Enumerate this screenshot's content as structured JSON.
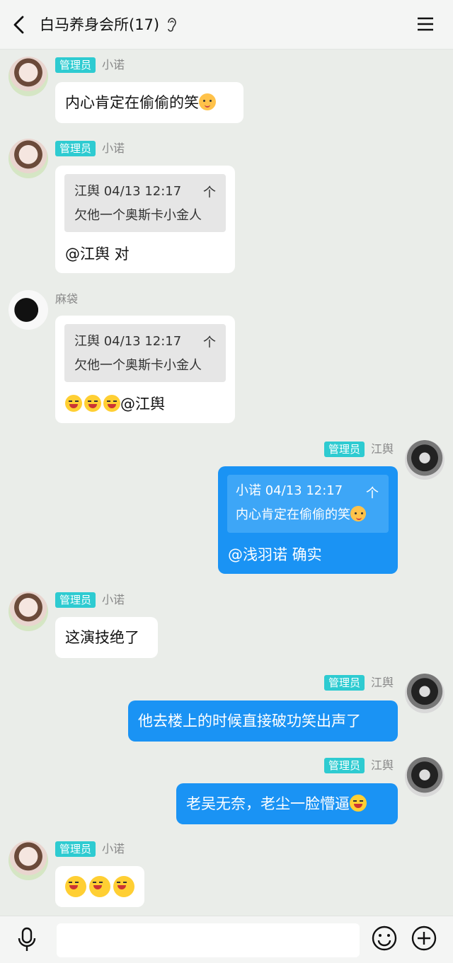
{
  "header": {
    "title": "白马养身会所(17)"
  },
  "roles": {
    "admin": "管理员"
  },
  "messages": [
    {
      "sender": "小诺",
      "role": "管理员",
      "text": "内心肯定在偷偷的笑",
      "emoji": "cat-face"
    },
    {
      "sender": "小诺",
      "role": "管理员",
      "quote": {
        "header": "江舆 04/13 12:17",
        "text": "欠他一个奥斯卡小金人",
        "arrow": "个"
      },
      "text": "@江舆 对"
    },
    {
      "sender": "麻袋",
      "quote": {
        "header": "江舆 04/13 12:17",
        "text": "欠他一个奥斯卡小金人",
        "arrow": "个"
      },
      "emoji_count": 3,
      "emoji": "laugh-face",
      "text": "@江舆"
    },
    {
      "sender": "江舆",
      "role": "管理员",
      "self": true,
      "quote": {
        "header": "小诺 04/13 12:17",
        "text": "内心肯定在偷偷的笑",
        "arrow": "个"
      },
      "text": "@浅羽诺 确实"
    },
    {
      "sender": "小诺",
      "role": "管理员",
      "text": "这演技绝了"
    },
    {
      "sender": "江舆",
      "role": "管理员",
      "self": true,
      "text": "他去楼上的时候直接破功笑出声了"
    },
    {
      "sender": "江舆",
      "role": "管理员",
      "self": true,
      "text": "老吴无奈，老尘一脸懵逼",
      "emoji": "laugh-face"
    },
    {
      "sender": "小诺",
      "role": "管理员",
      "emoji_count": 3,
      "emoji": "laugh-face"
    }
  ],
  "input": {
    "placeholder": ""
  },
  "colors": {
    "self_bubble": "#1a93f4",
    "admin_badge": "#2ecbd1",
    "background": "#eaede9"
  }
}
